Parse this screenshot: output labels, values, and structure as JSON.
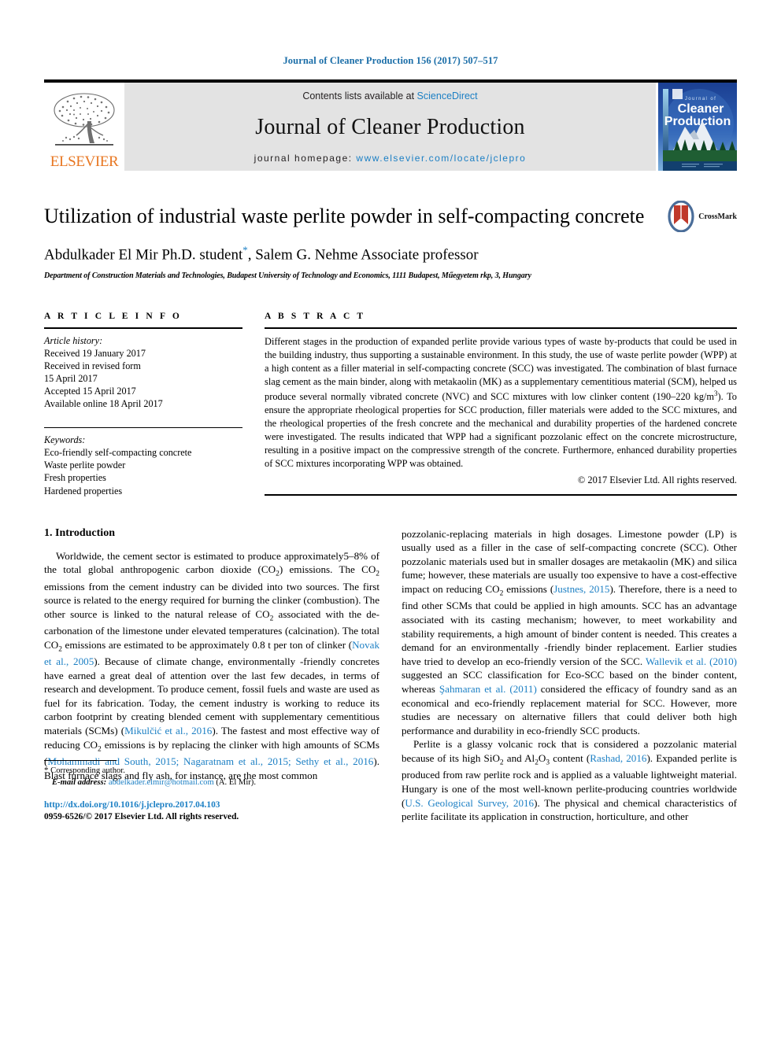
{
  "running_head": "Journal of Cleaner Production 156 (2017) 507–517",
  "masthead": {
    "contents_prefix": "Contents lists available at ",
    "sciencedirect": "ScienceDirect",
    "journal_name": "Journal of Cleaner Production",
    "homepage_prefix": "journal homepage: ",
    "homepage_url": "www.elsevier.com/locate/jclepro",
    "publisher": "ELSEVIER",
    "cover_title_small": "Journal of",
    "cover_title_line1": "Cleaner",
    "cover_title_line2": "Production",
    "accent_blue": "#1b7fc4",
    "elsevier_orange": "#e87722",
    "masthead_bg": "#e3e3e3"
  },
  "title": {
    "text": "Utilization of industrial waste perlite powder in self-compacting concrete",
    "crossmark_label": "CrossMark"
  },
  "authors": {
    "line_a": "Abdulkader El Mir Ph.D. student",
    "corresponding_marker": "*",
    "line_b": ", Salem G. Nehme Associate professor",
    "affiliation": "Department of Construction Materials and Technologies, Budapest University of Technology and Economics, 1111 Budapest, Műegyetem rkp, 3, Hungary"
  },
  "article_info": {
    "heading": "A R T I C L E  I N F O",
    "history_label": "Article history:",
    "history": [
      "Received 19 January 2017",
      "Received in revised form",
      "15 April 2017",
      "Accepted 15 April 2017",
      "Available online 18 April 2017"
    ],
    "keywords_label": "Keywords:",
    "keywords": [
      "Eco-friendly self-compacting concrete",
      "Waste perlite powder",
      "Fresh properties",
      "Hardened properties"
    ]
  },
  "abstract": {
    "heading": "A B S T R A C T",
    "part1": "Different stages in the production of expanded perlite provide various types of waste by-products that could be used in the building industry, thus supporting a sustainable environment. In this study, the use of waste perlite powder (WPP) at a high content as a filler material in self-compacting concrete (SCC) was investigated. The combination of blast furnace slag cement as the main binder, along with metakaolin (MK) as a supplementary cementitious material (SCM), helped us produce several normally vibrated concrete (NVC) and SCC mixtures with low clinker content (190–220 kg/m",
    "superscript": "3",
    "part2": "). To ensure the appropriate rheological properties for SCC production, filler materials were added to the SCC mixtures, and the rheological properties of the fresh concrete and the mechanical and durability properties of the hardened concrete were investigated. The results indicated that WPP had a significant pozzolanic effect on the concrete microstructure, resulting in a positive impact on the compressive strength of the concrete. Furthermore, enhanced durability properties of SCC mixtures incorporating WPP was obtained.",
    "copyright": "© 2017 Elsevier Ltd. All rights reserved."
  },
  "introduction": {
    "heading": "1. Introduction",
    "left_p1_a": "Worldwide, the cement sector is estimated to produce approximately5–8% of the total global anthropogenic carbon dioxide (CO",
    "left_sub1": "2",
    "left_p1_b": ") emissions. The CO",
    "left_sub2": "2",
    "left_p1_c": " emissions from the cement industry can be divided into two sources. The first source is related to the energy required for burning the clinker (combustion). The other source is linked to the natural release of CO",
    "left_sub3": "2",
    "left_p1_d": " associated with the de-carbonation of the limestone under elevated temperatures (calcination). The total CO",
    "left_sub4": "2",
    "left_p1_e": " emissions are estimated to be approximately 0.8 t per ton of clinker (",
    "ref_novak": "Novak et al., 2005",
    "left_p1_f": "). Because of climate change, environmentally -friendly concretes have earned a great deal of attention over the last few decades, in terms of research and development. To produce cement, fossil fuels and waste are used as fuel for its fabrication. Today, the cement industry is working to reduce its carbon footprint by creating blended cement with supplementary cementitious materials (SCMs) (",
    "ref_mikulcic": "Mikulčić et al., 2016",
    "left_p1_g": "). The fastest and most effective way of reducing CO",
    "left_sub5": "2",
    "left_p1_h": " emissions is by replacing the clinker with high amounts of SCMs (",
    "ref_mohammadi": "Mohammadi and South, 2015; Nagaratnam et al., 2015; Sethy et al., 2016",
    "left_p1_i": "). Blast furnace slags and fly ash, for instance, are the most common",
    "right_p1_a": "pozzolanic-replacing materials in high dosages. Limestone powder (LP) is usually used as a filler in the case of self-compacting concrete (SCC). Other pozzolanic materials used but in smaller dosages are metakaolin (MK) and silica fume; however, these materials are usually too expensive to have a cost-effective impact on reducing CO",
    "right_sub1": "2",
    "right_p1_b": " emissions (",
    "ref_justnes": "Justnes, 2015",
    "right_p1_c": "). Therefore, there is a need to find other SCMs that could be applied in high amounts. SCC has an advantage associated with its casting mechanism; however, to meet workability and stability requirements, a high amount of binder content is needed. This creates a demand for an environmentally -friendly binder replacement. Earlier studies have tried to develop an eco-friendly version of the SCC. ",
    "ref_wallevik": "Wallevik et al. (2010)",
    "right_p1_d": " suggested an SCC classification for Eco-SCC based on the binder content, whereas ",
    "ref_sahmaran": "Şahmaran et al. (2011)",
    "right_p1_e": " considered the efficacy of foundry sand as an economical and eco-friendly replacement material for SCC. However, more studies are necessary on alternative fillers that could deliver both high performance and durability in eco-friendly SCC products.",
    "right_p2_a": "Perlite is a glassy volcanic rock that is considered a pozzolanic material because of its high SiO",
    "right_sub2": "2",
    "right_p2_b": " and Al",
    "right_sub3": "2",
    "right_p2_c": "O",
    "right_sub4": "3",
    "right_p2_d": " content (",
    "ref_rashad": "Rashad, 2016",
    "right_p2_e": "). Expanded perlite is produced from raw perlite rock and is applied as a valuable lightweight material. Hungary is one of the most well-known perlite-producing countries worldwide (",
    "ref_usgs": "U.S. Geological Survey, 2016",
    "right_p2_f": "). The physical and chemical characteristics of perlite facilitate its application in construction, horticulture, and other"
  },
  "footnote": {
    "star": "*",
    "corresponding": " Corresponding author.",
    "email_label": "E-mail address:",
    "email": "abdelkader.elmir@hotmail.com",
    "email_suffix": " (A. El Mir)."
  },
  "footer": {
    "doi": "http://dx.doi.org/10.1016/j.jclepro.2017.04.103",
    "issn_line": "0959-6526/© 2017 Elsevier Ltd. All rights reserved."
  }
}
